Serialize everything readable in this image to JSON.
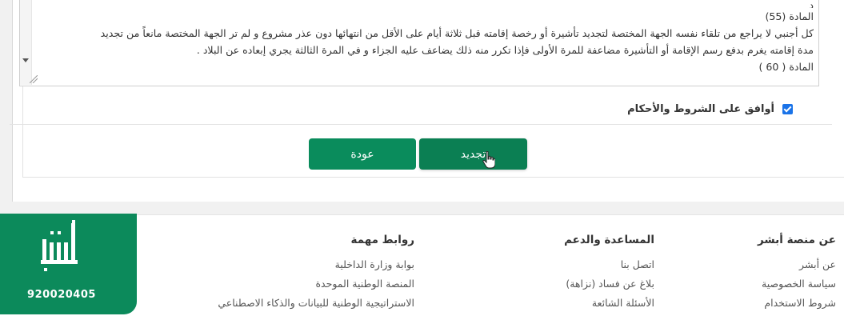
{
  "terms": {
    "top_fragment": "د",
    "article_55": "المادة (55)",
    "line_1": "كل أجنبي لا يراجع من تلقاء نفسه الجهة المختصة لتجديد تأشيرة أو رخصة إقامته قبل ثلاثة أيام على الأقل من انتهائها دون عذر مشروع و لم تر الجهة المختصة مانعاً من تجديد",
    "line_2": "مدة إقامته يغرم بدفع رسم الإقامة أو التأشيرة مضاعفة للمرة الأولى فإذا تكرر منه ذلك يضاعف عليه الجزاء و في المرة الثالثة يجري إبعاده عن البلاد .",
    "article_60": "المادة ( 60 )"
  },
  "agree": {
    "label": "أوافق على الشروط والأحكام",
    "checked": true
  },
  "buttons": {
    "renew": "تجديد",
    "back": "عودة"
  },
  "footer": {
    "about": {
      "heading": "عن منصة أبشر",
      "links": [
        "عن أبشر",
        "سياسة الخصوصية",
        "شروط الاستخدام"
      ]
    },
    "support": {
      "heading": "المساعدة والدعم",
      "links": [
        "اتصل بنا",
        "بلاغ عن فساد (نزاهة)",
        "الأسئلة الشائعة"
      ]
    },
    "links": {
      "heading": "روابط مهمة",
      "items": [
        "بوابة وزارة الداخلية",
        "المنصة الوطنية الموحدة",
        "الاستراتيجية الوطنية للبيانات والذكاء الاصطناعي"
      ]
    },
    "logo": {
      "phone": "920020405"
    }
  },
  "colors": {
    "brand_green": "#0a8c5c",
    "checkbox_blue": "#1a73e8"
  }
}
